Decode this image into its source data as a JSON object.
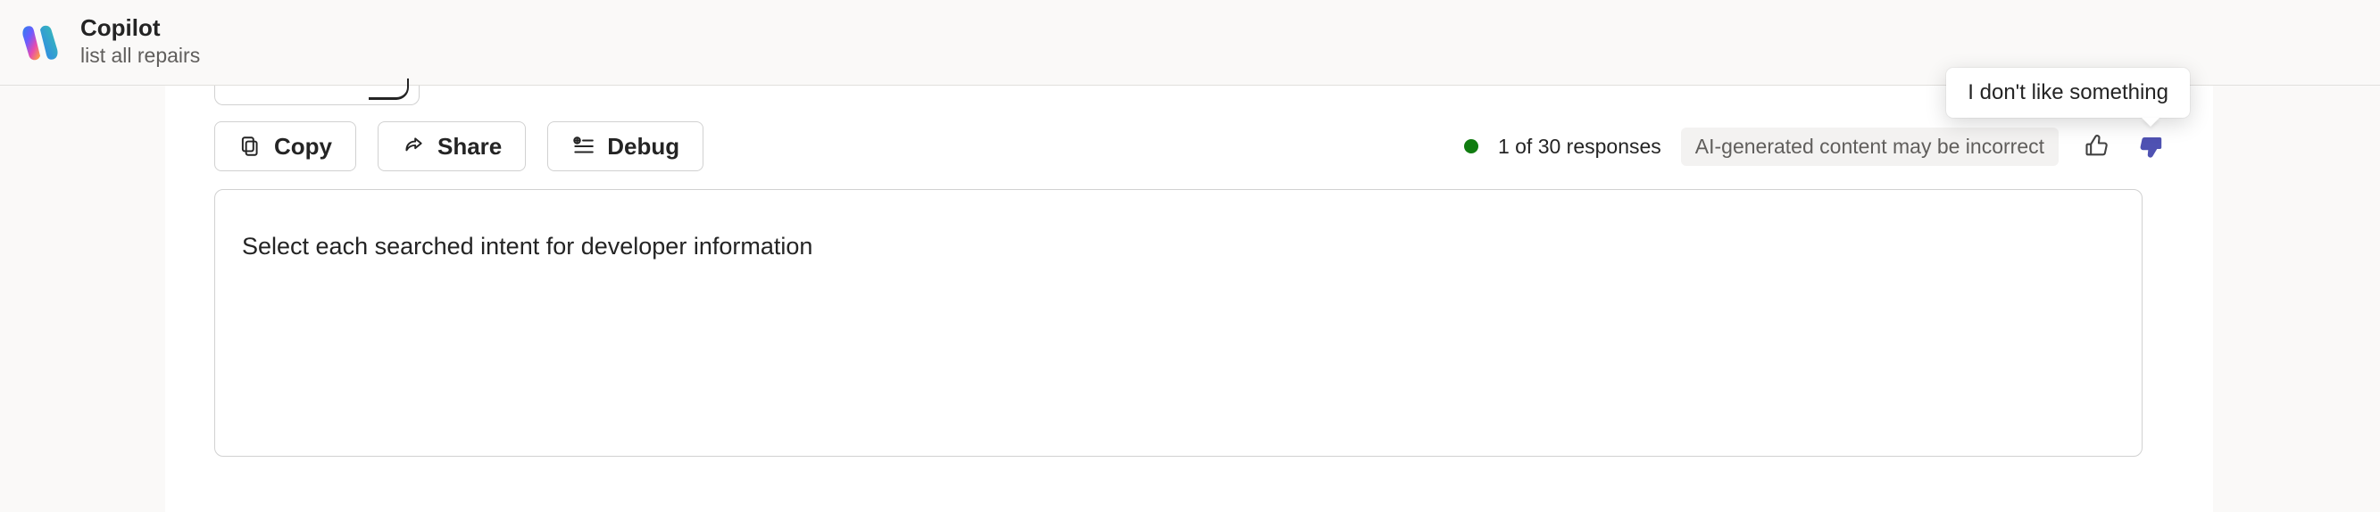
{
  "header": {
    "title": "Copilot",
    "subtitle": "list all repairs"
  },
  "toolbar": {
    "copy_label": "Copy",
    "share_label": "Share",
    "debug_label": "Debug"
  },
  "status": {
    "counter": "1 of 30 responses",
    "disclaimer": "AI-generated content may be incorrect",
    "dot_color": "#107c10"
  },
  "feedback": {
    "tooltip": "I don't like something"
  },
  "panel": {
    "prompt": "Select each searched intent for developer information"
  },
  "colors": {
    "accent": "#4f52b2"
  }
}
